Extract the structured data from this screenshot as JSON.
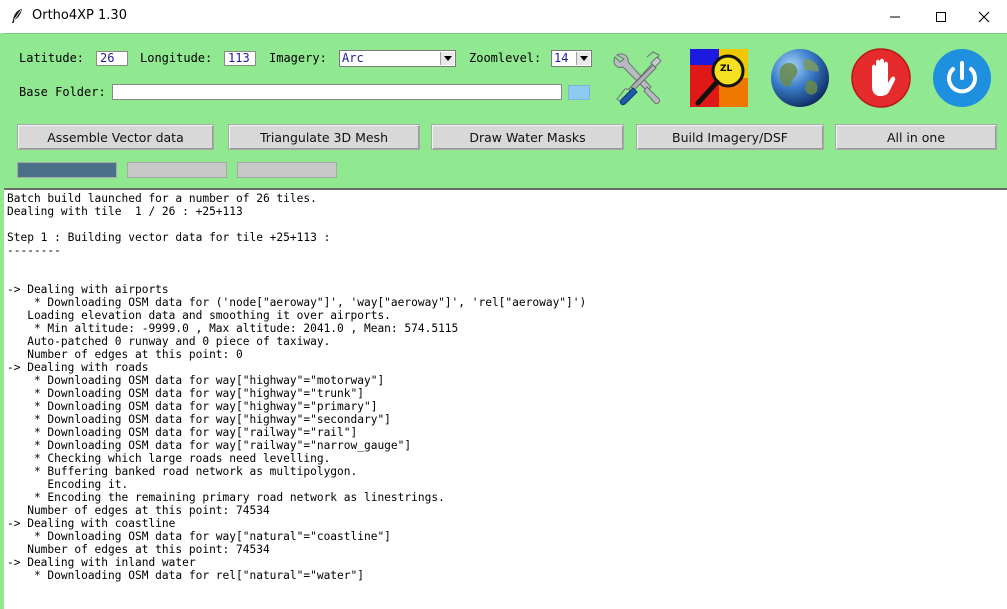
{
  "window": {
    "title": "Ortho4XP 1.30",
    "controls": [
      "minimize-icon",
      "maximize-icon",
      "close-icon"
    ]
  },
  "form": {
    "latitude_label": "Latitude:",
    "latitude_value": "26",
    "longitude_label": "Longitude:",
    "longitude_value": "113",
    "imagery_label": "Imagery:",
    "imagery_value": "Arc",
    "zoomlevel_label": "Zoomlevel:",
    "zoomlevel_value": "14",
    "base_folder_label": "Base Folder:",
    "base_folder_value": ""
  },
  "icon_buttons": [
    "tools-icon",
    "zoomlevel-map-icon",
    "globe-icon",
    "stop-hand-icon",
    "power-icon"
  ],
  "zl_badge": "ZL",
  "actions": {
    "assemble": "Assemble Vector data",
    "triangulate": "Triangulate 3D Mesh",
    "masks": "Draw Water Masks",
    "build": "Build Imagery/DSF",
    "all": "All in one"
  },
  "progress": {
    "bar1": 1.0,
    "bar2": 0.0,
    "bar3": 0.0
  },
  "colors": {
    "panel": "#90e890",
    "progress_fill": "#4c6f8a",
    "stop_red": "#e52b2b",
    "power_blue": "#1f8fe0"
  },
  "log": [
    "Batch build launched for a number of 26 tiles.",
    "Dealing with tile  1 / 26 : +25+113",
    "",
    "Step 1 : Building vector data for tile +25+113 :",
    "--------",
    "",
    "",
    "-> Dealing with airports",
    "    * Downloading OSM data for ('node[\"aeroway\"]', 'way[\"aeroway\"]', 'rel[\"aeroway\"]')",
    "   Loading elevation data and smoothing it over airports.",
    "    * Min altitude: -9999.0 , Max altitude: 2041.0 , Mean: 574.5115",
    "   Auto-patched 0 runway and 0 piece of taxiway.",
    "   Number of edges at this point: 0",
    "-> Dealing with roads",
    "    * Downloading OSM data for way[\"highway\"=\"motorway\"]",
    "    * Downloading OSM data for way[\"highway\"=\"trunk\"]",
    "    * Downloading OSM data for way[\"highway\"=\"primary\"]",
    "    * Downloading OSM data for way[\"highway\"=\"secondary\"]",
    "    * Downloading OSM data for way[\"railway\"=\"rail\"]",
    "    * Downloading OSM data for way[\"railway\"=\"narrow_gauge\"]",
    "    * Checking which large roads need levelling.",
    "    * Buffering banked road network as multipolygon.",
    "      Encoding it.",
    "    * Encoding the remaining primary road network as linestrings.",
    "   Number of edges at this point: 74534",
    "-> Dealing with coastline",
    "    * Downloading OSM data for way[\"natural\"=\"coastline\"]",
    "   Number of edges at this point: 74534",
    "-> Dealing with inland water",
    "    * Downloading OSM data for rel[\"natural\"=\"water\"]"
  ]
}
